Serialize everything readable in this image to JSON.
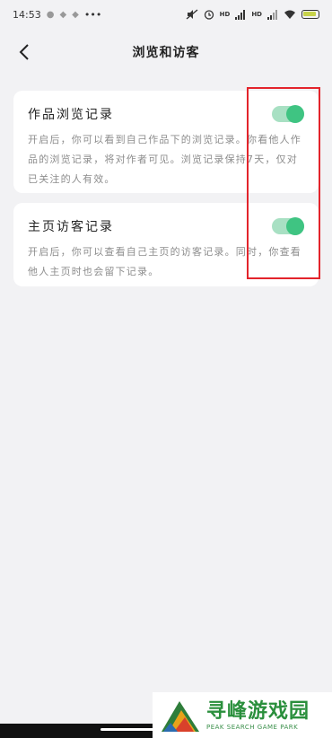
{
  "status_bar": {
    "time": "14:53",
    "more": "•••",
    "hd1": "HD",
    "hd2": "HD"
  },
  "header": {
    "title": "浏览和访客"
  },
  "settings": [
    {
      "title": "作品浏览记录",
      "description": "开启后，你可以看到自己作品下的浏览记录。你看他人作品的浏览记录，将对作者可见。浏览记录保持7天，仅对已关注的人有效。",
      "enabled": true
    },
    {
      "title": "主页访客记录",
      "description": "开启后，你可以查看自己主页的访客记录。同时，你查看他人主页时也会留下记录。",
      "enabled": true
    }
  ],
  "watermark": {
    "name": "寻峰游戏园",
    "subtitle": "PEAK SEARCH GAME PARK"
  },
  "colors": {
    "toggle_on": "#3fc482",
    "toggle_track": "#a8e0c3",
    "highlight": "#e3242b",
    "background": "#f2f2f4"
  }
}
